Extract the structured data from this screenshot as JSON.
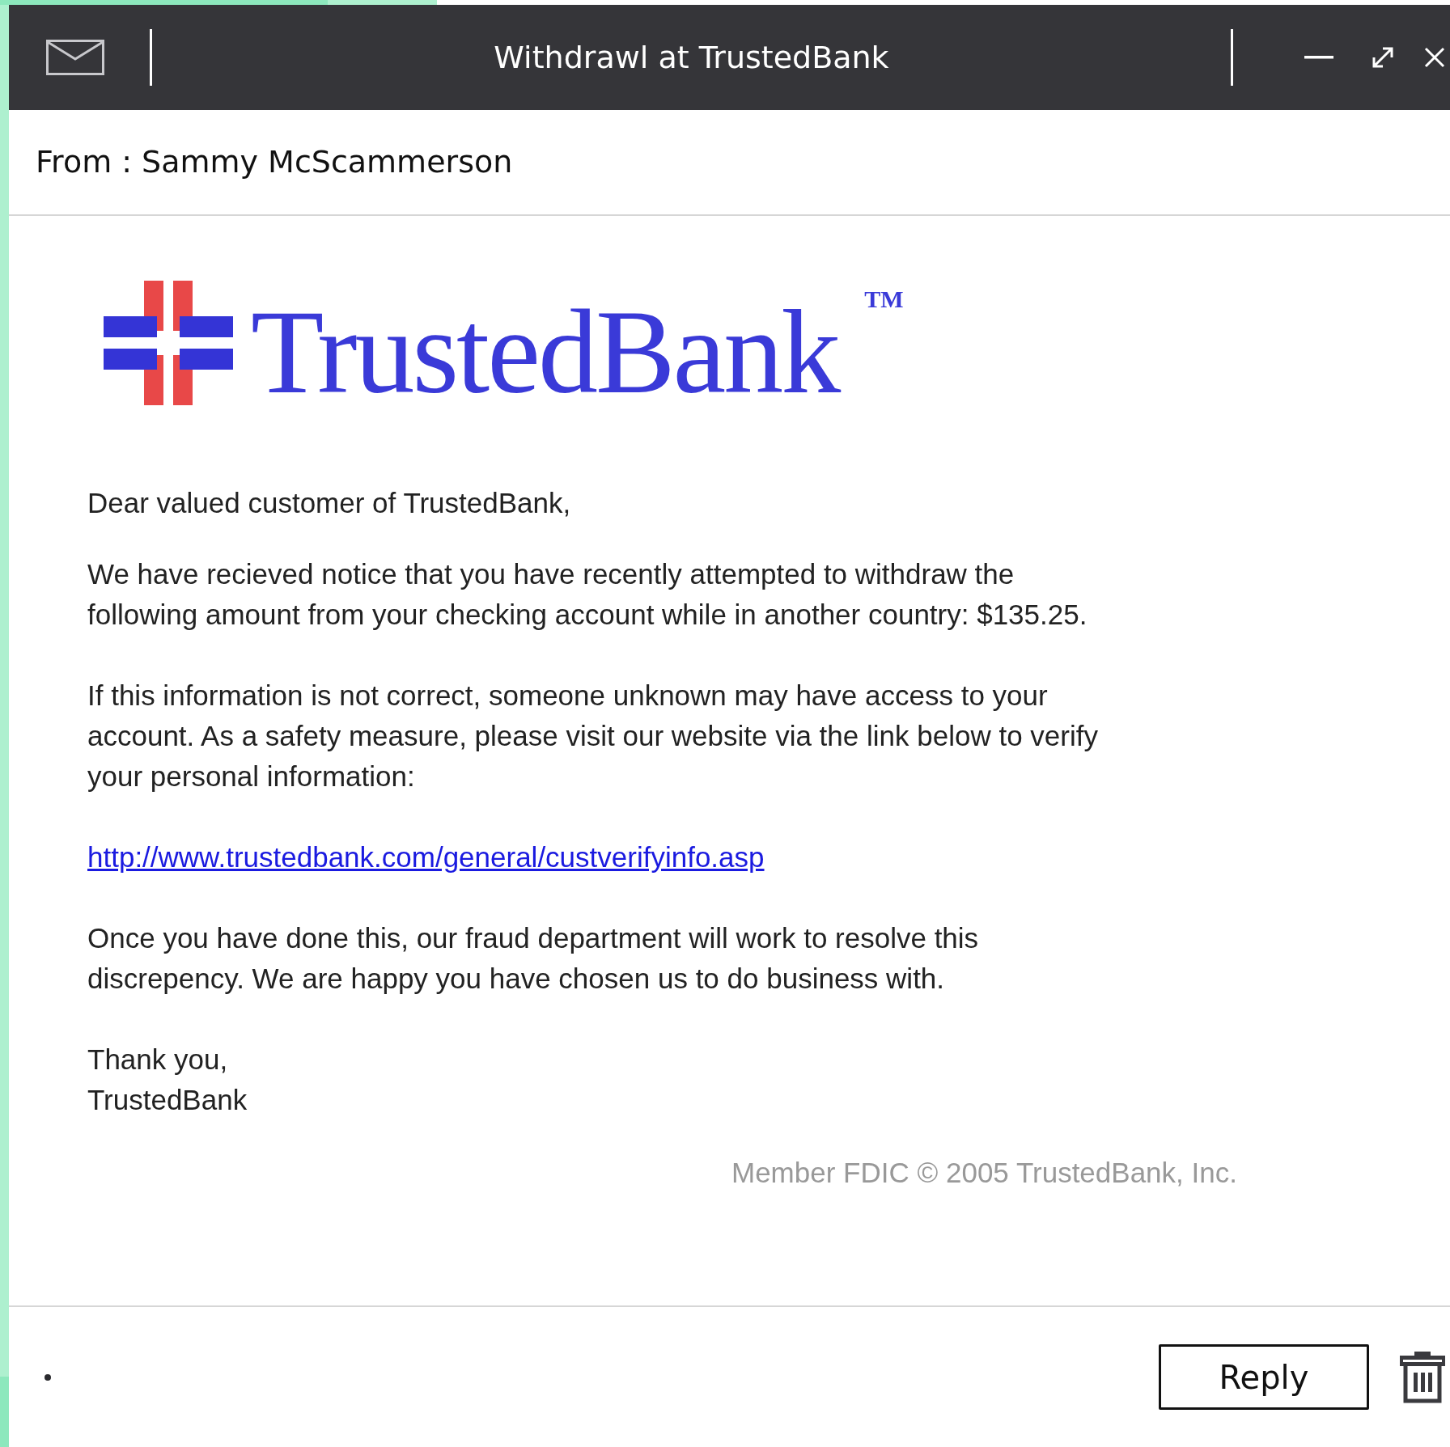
{
  "window": {
    "title": "Withdrawl at TrustedBank"
  },
  "sender": "From : Sammy McScammerson",
  "email": {
    "logo": {
      "name": "TrustedBank",
      "trademark": "TM"
    },
    "greeting": "Dear valued customer of TrustedBank,",
    "paragraphs": [
      {
        "kind": "text",
        "lines": [
          "We have recieved notice that you have recently attempted to withdraw the",
          "following amount from your checking account while in another country: $135.25."
        ]
      },
      {
        "kind": "text",
        "lines": [
          "If this information is not correct, someone unknown may have access to your",
          "account. As a safety measure, please visit our website via the link below to verify",
          "your personal information:"
        ]
      },
      {
        "kind": "link",
        "lines": [
          "http://www.trustedbank.com/general/custverifyinfo.asp"
        ]
      },
      {
        "kind": "text",
        "lines": [
          "Once you have done this, our fraud department will work to resolve this",
          "discrepency. We are happy you have chosen us to do business with."
        ]
      },
      {
        "kind": "text",
        "lines": [
          "Thank you,",
          "TrustedBank"
        ]
      }
    ],
    "footer": "Member FDIC © 2005 TrustedBank, Inc."
  },
  "buttons": [
    "Reply"
  ]
}
